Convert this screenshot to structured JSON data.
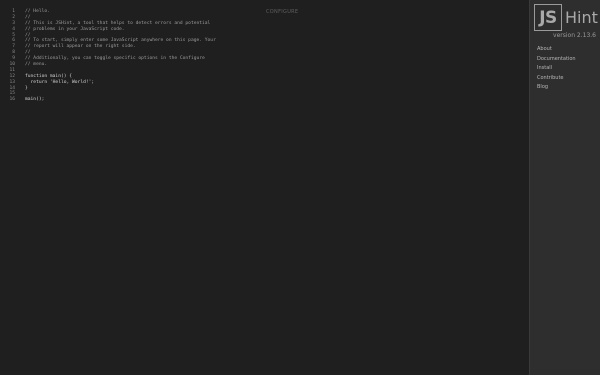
{
  "editor": {
    "configure_label": "CONFIGURE",
    "lines": [
      {
        "number": "1",
        "text": "// Hello.",
        "kind": "comment"
      },
      {
        "number": "2",
        "text": "//",
        "kind": "comment"
      },
      {
        "number": "3",
        "text": "// This is JSHint, a tool that helps to detect errors and potential",
        "kind": "comment"
      },
      {
        "number": "4",
        "text": "// problems in your JavaScript code.",
        "kind": "comment"
      },
      {
        "number": "5",
        "text": "//",
        "kind": "comment"
      },
      {
        "number": "6",
        "text": "// To start, simply enter some JavaScript anywhere on this page. Your",
        "kind": "comment"
      },
      {
        "number": "7",
        "text": "// report will appear on the right side.",
        "kind": "comment"
      },
      {
        "number": "8",
        "text": "//",
        "kind": "comment"
      },
      {
        "number": "9",
        "text": "// Additionally, you can toggle specific options in the Configure",
        "kind": "comment"
      },
      {
        "number": "10",
        "text": "// menu.",
        "kind": "comment"
      },
      {
        "number": "11",
        "text": "",
        "kind": "code"
      },
      {
        "number": "12",
        "text": "function main() {",
        "kind": "code"
      },
      {
        "number": "13",
        "text": "  return 'Hello, World!';",
        "kind": "code"
      },
      {
        "number": "14",
        "text": "}",
        "kind": "code"
      },
      {
        "number": "15",
        "text": "",
        "kind": "code"
      },
      {
        "number": "16",
        "text": "main();",
        "kind": "code"
      }
    ]
  },
  "sidebar": {
    "logo_js": "JS",
    "logo_hint": "Hint",
    "version": "version 2.13.6",
    "nav": [
      {
        "label": "About",
        "name": "nav-about"
      },
      {
        "label": "Documentation",
        "name": "nav-documentation"
      },
      {
        "label": "Install",
        "name": "nav-install"
      },
      {
        "label": "Contribute",
        "name": "nav-contribute"
      },
      {
        "label": "Blog",
        "name": "nav-blog"
      }
    ]
  }
}
